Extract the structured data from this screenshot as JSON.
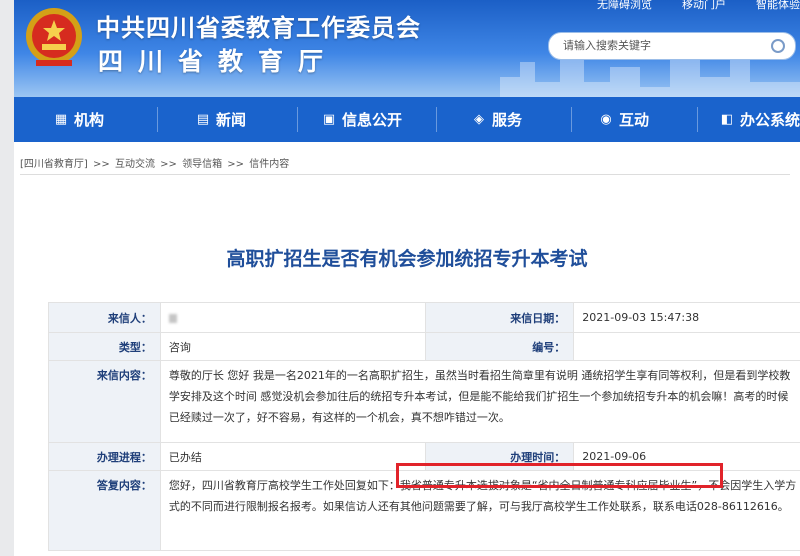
{
  "header": {
    "title": "中共四川省委教育工作委员会",
    "subtitle": "四川省教育厅",
    "top_links": [
      "无障碍浏览",
      "移动门户",
      "智能体验"
    ],
    "search_placeholder": "请输入搜索关键字"
  },
  "nav": {
    "items": [
      {
        "label": "机构",
        "icon": "building-icon"
      },
      {
        "label": "新闻",
        "icon": "news-icon"
      },
      {
        "label": "信息公开",
        "icon": "info-icon"
      },
      {
        "label": "服务",
        "icon": "service-icon"
      },
      {
        "label": "互动",
        "icon": "chat-icon"
      },
      {
        "label": "办公系统",
        "icon": "office-icon"
      }
    ]
  },
  "breadcrumb": [
    "[四川省教育厅]",
    ">>",
    "互动交流",
    ">>",
    "领导信箱",
    ">>",
    "信件内容"
  ],
  "article": {
    "title": "高职扩招生是否有机会参加统招专升本考试",
    "labels": {
      "sender": "来信人：",
      "date": "来信日期：",
      "type": "类型：",
      "number": "编号：",
      "content": "来信内容：",
      "progress": "办理进程：",
      "time": "办理时间：",
      "reply": "答复内容："
    },
    "date_value": "2021-09-03 15:47:38",
    "type_value": "咨询",
    "number_value": "",
    "content_value": "尊敬的厅长 您好 我是一名2021年的一名高职扩招生，虽然当时看招生简章里有说明 通统招学生享有同等权利，但是看到学校教学安排及这个时间 感觉没机会参加往后的统招专升本考试，但是能不能给我们扩招生一个参加统招专升本的机会嘛！高考的时候已经赎过一次了，好不容易，有这样的一个机会，真不想咋错过一次。",
    "progress_value": "已办结",
    "time_value": "2021-09-06",
    "reply_value": "您好，四川省教育厅高校学生工作处回复如下：我省普通专升本选拔对象是“省内全日制普通专科应届毕业生”，不会因学生入学方式的不同而进行限制报名报考。如果信访人还有其他问题需要了解，可与我厅高校学生工作处联系，联系电话028-86112616。"
  },
  "colors": {
    "nav_blue": "#1a63cc",
    "title_blue": "#1f4e9a",
    "highlight_red": "#e1232a"
  }
}
